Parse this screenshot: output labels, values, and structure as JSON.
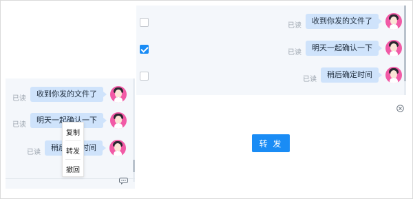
{
  "left_chat": {
    "messages": [
      {
        "read_label": "已读",
        "text": "收到你发的文件了"
      },
      {
        "read_label": "已读",
        "text": "明天一起确认一下"
      },
      {
        "read_label": "已读",
        "text": "稍后确定时间"
      }
    ]
  },
  "context_menu": {
    "items": [
      {
        "label": "复制"
      },
      {
        "label": "转发"
      },
      {
        "label": "撤回"
      }
    ]
  },
  "forward_panel": {
    "messages": [
      {
        "read_label": "已读",
        "text": "收到你发的文件了",
        "checked": false
      },
      {
        "read_label": "已读",
        "text": "明天一起确认一下",
        "checked": true
      },
      {
        "read_label": "已读",
        "text": "稍后确定时间",
        "checked": false
      }
    ],
    "forward_label": "转 发"
  },
  "icons": {
    "comment": "comment-icon",
    "close": "close-circle-icon",
    "avatar": "avatar-icon"
  },
  "colors": {
    "bubble": "#cfe3fb",
    "panel": "#f4f7fb",
    "accent": "#1a8cf5",
    "avatar": "#f15aa6"
  }
}
